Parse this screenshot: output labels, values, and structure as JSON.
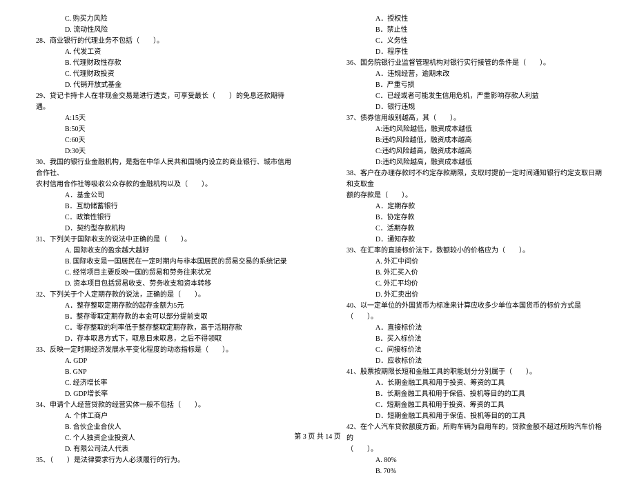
{
  "left": {
    "pre_opts": [
      "C. 购买力风险",
      "D. 流动性风险"
    ],
    "q28": "28、商业银行的代理业务不包括（　　）。",
    "q28_opts": [
      "A. 代发工资",
      "B. 代理财政性存款",
      "C. 代理财政投资",
      "D. 代销开放式基金"
    ],
    "q29": "29、贷记卡持卡人在非现金交易是进行透支，可享受最长（　　）的免息还款期待遇。",
    "q29_opts": [
      "A:15天",
      "B:50天",
      "C:60天",
      "D:30天"
    ],
    "q30": "30、我国的银行业金融机构，是指在中华人民共和国境内设立的商业银行、城市信用合作社、",
    "q30_cont": "农村信用合作社等吸收公众存款的金融机构以及（　　）。",
    "q30_opts": [
      "A．基金公司",
      "B．互助储蓄银行",
      "C．政策性银行",
      "D．契约型存款机构"
    ],
    "q31": "31、下列关于国际收支的说法中正确的是（　　）。",
    "q31_opts": [
      "A. 国际收支的盈余越大越好",
      "B. 国际收支是一国居民在一定时期内与非本国居民的贸易交易的系统记录",
      "C. 经常项目主要反映一国的贸易和劳务往来状况",
      "D. 资本项目包括贸易收支、劳务收支和资本转移"
    ],
    "q32": "32、下列关于个人定期存款的说法，正确的是（　　）。",
    "q32_opts": [
      "A．整存整取定期存款的起存金额为5元",
      "B．整存零取定期存款的本金可以部分提前支取",
      "C．零存整取的利率低于整存整取定期存款，高于活期存款",
      "D．存本取息方式下，取息日未取息，之后不得领取"
    ],
    "q33": "33、反映一定时期经济发展水平变化程度的动态指标是（　　）。",
    "q33_opts": [
      "A. GDP",
      "B. GNP",
      "C. 经济增长率",
      "D. GDP增长率"
    ],
    "q34": "34、申请个人经营贷款的经营实体一般不包括（　　）。",
    "q34_opts": [
      "A. 个体工商户",
      "B. 合伙企业合伙人",
      "C. 个人独资企业投资人",
      "D. 有限公司法人代表"
    ],
    "q35": "35、（　　）是法律要求行为人必须履行的行为。"
  },
  "right": {
    "pre_opts": [
      "A．授权性",
      "B．禁止性",
      "C．义务性",
      "D．程序性"
    ],
    "q36": "36、国务院银行业监督管理机构对银行实行接管的条件是（　　）。",
    "q36_opts": [
      "A．违规经营，逾期未改",
      "B．严重亏损",
      "C．已经或者可能发生信用危机，严重影响存款人利益",
      "D．银行违规"
    ],
    "q37": "37、债券信用级别越高，其（　　）。",
    "q37_opts": [
      "A:违约风险越低，融资成本越低",
      "B:违约风险越低，融资成本越高",
      "C:违约风险越高，融资成本越高",
      "D:违约风险越高，融资成本越低"
    ],
    "q38": "38、客户在办理存款时不约定存款期限，支取时提前一定时间通知银行约定支取日期和支取金",
    "q38_cont": "额的存款是（　　）。",
    "q38_opts": [
      "A．定期存款",
      "B．协定存款",
      "C．活期存款",
      "D．通知存款"
    ],
    "q39": "39、在汇率的直接标价法下，数额较小的价格应为（　　）。",
    "q39_opts": [
      "A. 外汇中间价",
      "B. 外汇买入价",
      "C. 外汇平均价",
      "D. 外汇卖出价"
    ],
    "q40": "40、以一定单位的外国货币为标准来计算应收多少单位本国货币的标价方式是（　　）。",
    "q40_opts": [
      "A．直接标价法",
      "B．买入标价法",
      "C．间接标价法",
      "D．应收标价法"
    ],
    "q41": "41、股票按期限长短和金融工具的职能划分分别属于（　　）。",
    "q41_opts": [
      "A．长期金融工具和用于投资、筹资的工具",
      "B．长期金融工具和用于保值、投机等目的的工具",
      "C．短期金融工具和用于投资、筹资的工具",
      "D．短期金融工具和用于保值、投机等目的的工具"
    ],
    "q42": "42、在个人汽车贷款额度方面，所购车辆为自用车的，贷款金额不超过所购汽车价格的",
    "q42_cont": "（　　）。",
    "q42_opts": [
      "A. 80%",
      "B. 70%"
    ]
  },
  "footer": "第 3 页 共 14 页"
}
